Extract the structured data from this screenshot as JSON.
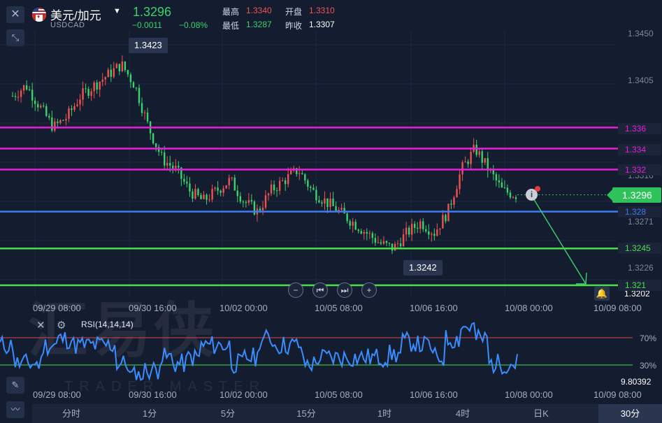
{
  "header": {
    "symbol_name": "美元/加元",
    "symbol_code": "USDCAD",
    "last_price": "1.3296",
    "change": "−0.0011",
    "change_pct": "−0.08%",
    "high_label": "最高",
    "high_value": "1.3340",
    "open_label": "开盘",
    "open_value": "1.3310",
    "low_label": "最低",
    "low_value": "1.3287",
    "prev_close_label": "昨收",
    "prev_close_value": "1.3307"
  },
  "icons": {
    "close": "close-icon",
    "shrink": "shrink-icon",
    "caret": "chevron-down-icon",
    "info": "info-icon",
    "alarm": "bell-icon",
    "pen": "pencil-icon",
    "indicator": "indicator-icon",
    "gear": "gear-icon"
  },
  "colors": {
    "up": "#f0534f",
    "down": "#3ad36c",
    "magenta_line": "#e81ed8",
    "blue_line": "#3f7bf0",
    "green_line": "#4be04a",
    "rsi_line": "#3a8cff"
  },
  "chart": {
    "price_axis": [
      "1.3450",
      "1.3405",
      "1.3316",
      "1.3271",
      "1.3226",
      "1.3202"
    ],
    "horizontal_lines": [
      {
        "value": "1.336",
        "color": "#e81ed8"
      },
      {
        "value": "1.334",
        "color": "#e81ed8"
      },
      {
        "value": "1.332",
        "color": "#e81ed8"
      },
      {
        "value": "1.328",
        "color": "#3f7bf0"
      },
      {
        "value": "1.3245",
        "color": "#4be04a"
      },
      {
        "value": "1.321",
        "color": "#4be04a"
      }
    ],
    "current_price_tag": "1.3296",
    "high_callout": "1.3423",
    "low_callout": "1.3242",
    "time_labels": [
      "09/29 08:00",
      "09/30 16:00",
      "10/02 00:00",
      "10/05 08:00",
      "10/06 16:00",
      "10/08 00:00",
      "10/09 08:00"
    ],
    "zoom_controls": [
      "−",
      "⏮",
      "⏭",
      "+"
    ]
  },
  "rsi": {
    "title": "RSI(14,14,14)",
    "level_high": "70%",
    "level_low": "30%",
    "value": "9.80392"
  },
  "watermark": {
    "title": "汇易侠",
    "subtitle": "TRADER MASTER"
  },
  "periods": [
    "分时",
    "1分",
    "5分",
    "15分",
    "1时",
    "4时",
    "日K",
    "30分"
  ],
  "active_period": "30分",
  "chart_data": {
    "type": "candlestick",
    "ylim": [
      1.32,
      1.3455
    ],
    "x_labels": [
      "09/29 08:00",
      "09/30 16:00",
      "10/02 00:00",
      "10/05 08:00",
      "10/06 16:00",
      "10/08 00:00",
      "10/09 08:00"
    ],
    "series": [
      {
        "values": [
          1.339,
          1.34,
          1.338,
          1.336,
          1.337,
          1.339,
          1.34,
          1.341,
          1.342,
          1.34,
          1.336,
          1.333,
          1.332,
          1.33,
          1.329,
          1.33,
          1.331,
          1.329,
          1.328,
          1.33,
          1.331,
          1.332,
          1.33,
          1.329,
          1.328,
          1.327,
          1.326,
          1.325,
          1.3245,
          1.326,
          1.327,
          1.326,
          1.328,
          1.332,
          1.334,
          1.332,
          1.33,
          1.3296
        ]
      }
    ],
    "levels": [
      1.336,
      1.334,
      1.332,
      1.328,
      1.3245,
      1.321
    ]
  }
}
